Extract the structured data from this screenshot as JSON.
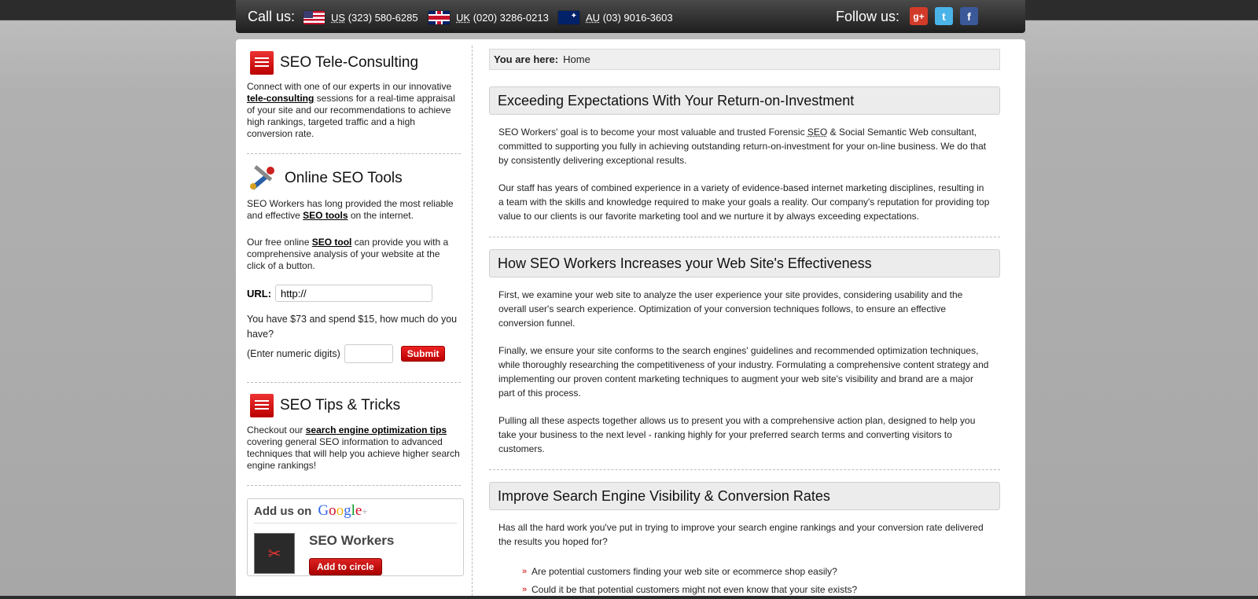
{
  "topbar": {
    "callus_label": "Call us:",
    "phones": [
      {
        "flag": "us-flag-icon",
        "code": "US",
        "number": "(323) 580-6285"
      },
      {
        "flag": "uk-flag-icon",
        "code": "UK",
        "number": "(020) 3286-0213"
      },
      {
        "flag": "au-flag-icon",
        "code": "AU",
        "number": "(03) 9016-3603"
      }
    ],
    "followus_label": "Follow us:",
    "social": {
      "gplus": "g+",
      "twitter": "t",
      "facebook": "f"
    }
  },
  "sidebar": {
    "tele": {
      "title": "SEO Tele-Consulting",
      "text_before": "Connect with one of our experts in our innovative ",
      "link": "tele-consulting",
      "text_after": " sessions for a real-time appraisal of your site and our recommendations to achieve high rankings, targeted traffic and a high conversion rate."
    },
    "tools": {
      "title": "Online SEO Tools",
      "p1_before": "SEO Workers has long provided the most reliable and effective ",
      "p1_link": "SEO tools",
      "p1_after": " on the internet.",
      "p2_before": "Our free online ",
      "p2_link": "SEO tool",
      "p2_after": " can provide you with a comprehensive analysis of your website at the click of a button.",
      "url_label": "URL:",
      "url_value": "http://",
      "question": "You have $73 and spend $15, how much do you have?",
      "digits_label": "(Enter numeric digits)",
      "submit_label": "Submit"
    },
    "tips": {
      "title": "SEO Tips & Tricks",
      "text_before": "Checkout our ",
      "link": "search engine optimization tips",
      "text_after": " covering general SEO information to advanced techniques that will help you achieve higher search engine rankings!"
    },
    "gplus_box": {
      "add_label": "Add us on",
      "logo": [
        "G",
        "o",
        "o",
        "g",
        "l",
        "e",
        "+"
      ],
      "name": "SEO Workers",
      "circle_button": "Add to circle"
    }
  },
  "main": {
    "breadcrumb_label": "You are here:",
    "breadcrumb_current": "Home",
    "sec1": {
      "title": "Exceeding Expectations With Your Return-on-Investment",
      "p1_before": "SEO Workers' goal is to become your most valuable and trusted Forensic ",
      "p1_abbr": "SEO",
      "p1_after": " & Social Semantic Web consultant, committed to supporting you fully in achieving outstanding return-on-investment for your on-line business. We do that by consistently delivering exceptional results.",
      "p2": "Our staff has years of combined experience in a variety of evidence-based internet marketing disciplines, resulting in a team with the skills and knowledge required to make your goals a reality. Our company's reputation for providing top value to our clients is our favorite marketing tool and we nurture it by always exceeding expectations."
    },
    "sec2": {
      "title": "How SEO Workers Increases your Web Site's Effectiveness",
      "p1": "First, we examine your web site to analyze the user experience your site provides, considering usability and the overall user's search experience. Optimization of your conversion techniques follows, to ensure an effective conversion funnel.",
      "p2": "Finally, we ensure your site conforms to the search engines' guidelines and recommended optimization techniques, while thoroughly researching the competitiveness of your industry. Formulating a comprehensive content strategy and implementing our proven content marketing techniques to augment your web site's visibility and brand are a major part of this process.",
      "p3": "Pulling all these aspects together allows us to present you with a comprehensive action plan, designed to help you take your business to the next level - ranking highly for your preferred search terms and converting visitors to customers."
    },
    "sec3": {
      "title": "Improve Search Engine Visibility & Conversion Rates",
      "p1": "Has all the hard work you've put in trying to improve your search engine rankings and your conversion rate delivered the results you hoped for?",
      "bullets": [
        "Are potential customers finding your web site or ecommerce shop easily?",
        "Could it be that potential customers might not even know that your site exists?"
      ]
    }
  }
}
